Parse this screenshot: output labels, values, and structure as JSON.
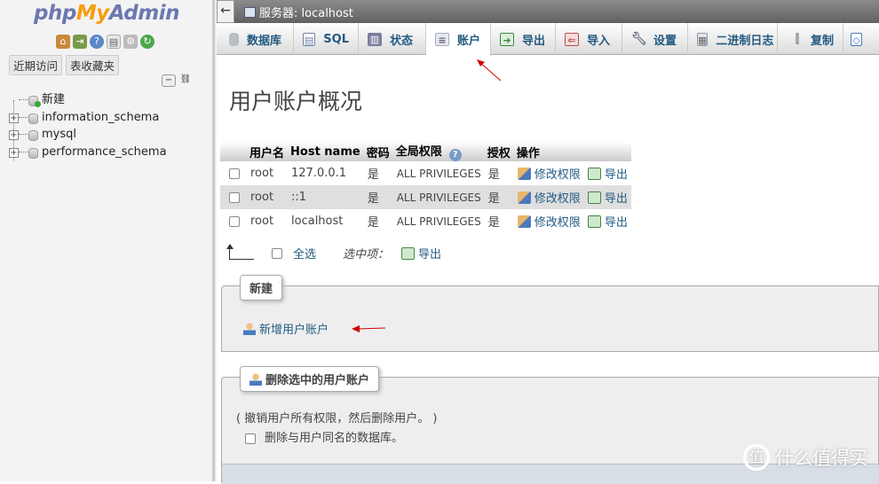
{
  "nav": {
    "logo_php": "php",
    "logo_my": "My",
    "logo_admin": "Admin",
    "icons": [
      "home-icon",
      "exit-icon",
      "help-icon",
      "docs-icon",
      "gear-icon",
      "reload-icon"
    ],
    "links": {
      "recent": "近期访问",
      "favorites": "表收藏夹"
    },
    "tree": [
      {
        "label": "新建"
      },
      {
        "label": "information_schema"
      },
      {
        "label": "mysql"
      },
      {
        "label": "performance_schema"
      }
    ]
  },
  "topbar": {
    "server": "服务器: localhost"
  },
  "tabs": [
    {
      "label": "数据库",
      "icon": "database-icon",
      "color": "#9aa3ad"
    },
    {
      "label": "SQL",
      "icon": "sql-icon",
      "color": "#7a8fb0"
    },
    {
      "label": "状态",
      "icon": "status-icon",
      "color": "#7d7d9d"
    },
    {
      "label": "账户",
      "icon": "accounts-icon",
      "color": "#b0b6c4"
    },
    {
      "label": "导出",
      "icon": "export-icon",
      "color": "#4a9a5a"
    },
    {
      "label": "导入",
      "icon": "import-icon",
      "color": "#c24a4a"
    },
    {
      "label": "设置",
      "icon": "wrench-icon",
      "color": "#8a8f99"
    },
    {
      "label": "二进制日志",
      "icon": "binlog-icon",
      "color": "#8f99a3"
    },
    {
      "label": "复制",
      "icon": "replication-icon",
      "color": "#9a9a9a"
    }
  ],
  "main": {
    "title": "用户账户概况",
    "table": {
      "headers": [
        "用户名",
        "Host name",
        "密码",
        "全局权限",
        "授权",
        "操作"
      ],
      "rows": [
        {
          "user": "root",
          "host": "127.0.0.1",
          "password": "是",
          "privileges": "ALL PRIVILEGES",
          "grant": "是",
          "edit": "修改权限",
          "export": "导出"
        },
        {
          "user": "root",
          "host": "::1",
          "password": "是",
          "privileges": "ALL PRIVILEGES",
          "grant": "是",
          "edit": "修改权限",
          "export": "导出"
        },
        {
          "user": "root",
          "host": "localhost",
          "password": "是",
          "privileges": "ALL PRIVILEGES",
          "grant": "是",
          "edit": "修改权限",
          "export": "导出"
        }
      ]
    },
    "with_selected": {
      "check_all": "全选",
      "label": "选中项：",
      "export": "导出"
    },
    "new_section": {
      "legend": "新建",
      "add_user": "新增用户账户"
    },
    "delete_section": {
      "legend": "删除选中的用户账户",
      "note": "( 撤销用户所有权限，然后删除用户。 )",
      "drop_db": "删除与用户同名的数据库。"
    },
    "arrow_color": "#cc0000"
  },
  "watermark": {
    "text": "什么值得买"
  }
}
